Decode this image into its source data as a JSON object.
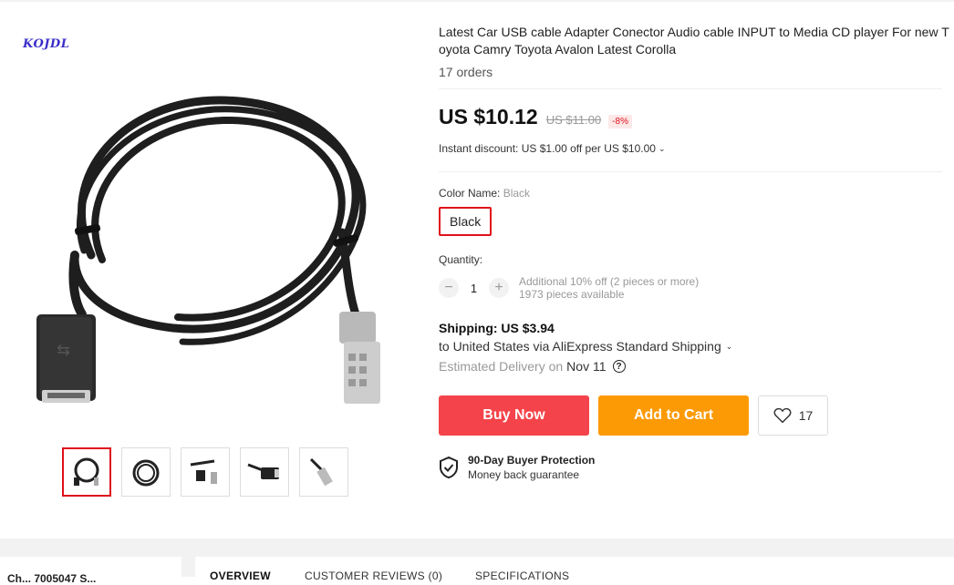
{
  "gallery": {
    "brand_logo": "KOJDL",
    "thumbnails": [
      "cable-coiled",
      "cable-coiled-alt",
      "cable-plugs",
      "usb-end",
      "connector-end"
    ]
  },
  "product": {
    "title": "Latest Car USB cable Adapter Conector Audio cable INPUT to Media CD player For new Toyota Camry Toyota Avalon Latest Corolla",
    "orders": "17 orders",
    "price": "US $10.12",
    "old_price": "US $11.00",
    "discount": "-8%",
    "instant_discount": "Instant discount: US $1.00 off per US $10.00",
    "color_label": "Color Name:",
    "color_value": "Black",
    "color_option": "Black",
    "quantity_label": "Quantity:",
    "quantity": "1",
    "qty_note_1": "Additional 10% off (2 pieces or more)",
    "qty_note_2": "1973 pieces available",
    "shipping_title": "Shipping: US $3.94",
    "shipping_desc": "to United States via AliExpress Standard Shipping",
    "delivery_label": "Estimated Delivery on",
    "delivery_date": "Nov 11",
    "buy_now": "Buy Now",
    "add_to_cart": "Add to Cart",
    "wishlist_count": "17",
    "protection_title": "90-Day Buyer Protection",
    "protection_sub": "Money back guarantee"
  },
  "bottom": {
    "store_text": "Ch... 7005047 S...",
    "tabs": [
      "OVERVIEW",
      "CUSTOMER REVIEWS (0)",
      "SPECIFICATIONS"
    ]
  },
  "colors": {
    "buy": "#f4434a",
    "cart": "#fc9a06",
    "accent": "#e0101a"
  }
}
